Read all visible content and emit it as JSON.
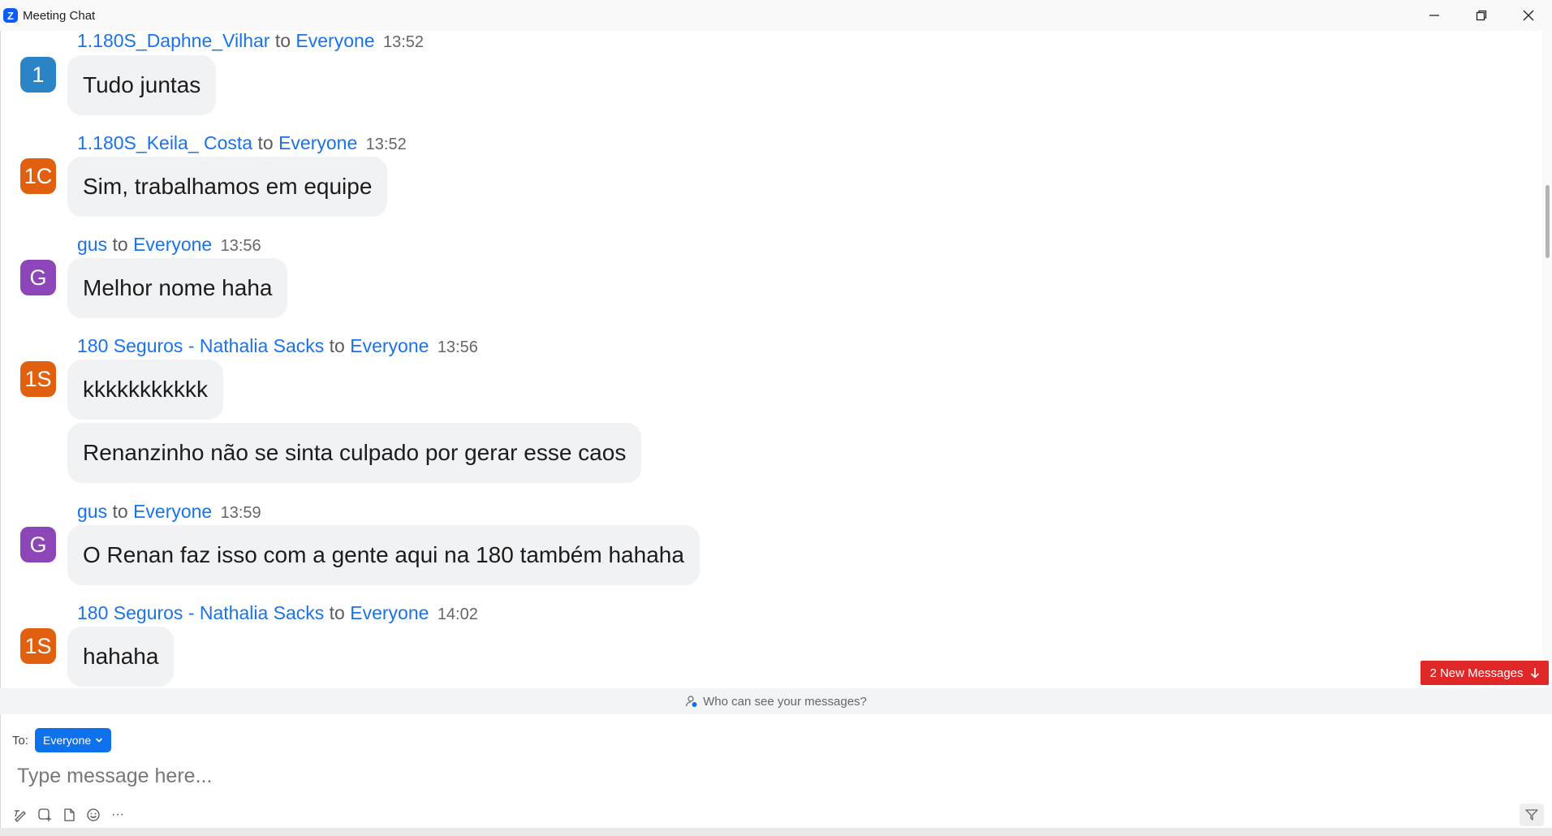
{
  "window": {
    "title": "Meeting Chat",
    "app_logo_letter": "Z"
  },
  "messages": [
    {
      "sender": "1.180S_Daphne_Vilhar",
      "to_word": "to",
      "recipient": "Everyone",
      "time": "13:52",
      "avatar_text": "1",
      "avatar_color": "#2b84c6",
      "bubbles": [
        "Tudo juntas"
      ]
    },
    {
      "sender": "1.180S_Keila_ Costa",
      "to_word": "to",
      "recipient": "Everyone",
      "time": "13:52",
      "avatar_text": "1C",
      "avatar_color": "#e0600f",
      "bubbles": [
        "Sim, trabalhamos em equipe"
      ]
    },
    {
      "sender": "gus",
      "to_word": "to",
      "recipient": "Everyone",
      "time": "13:56",
      "avatar_text": "G",
      "avatar_color": "#8c46b8",
      "bubbles": [
        "Melhor nome haha"
      ]
    },
    {
      "sender": "180 Seguros - Nathalia Sacks",
      "to_word": "to",
      "recipient": "Everyone",
      "time": "13:56",
      "avatar_text": "1S",
      "avatar_color": "#e0600f",
      "bubbles": [
        "kkkkkkkkkkk",
        "Renanzinho não se sinta culpado por gerar esse caos"
      ]
    },
    {
      "sender": "gus",
      "to_word": "to",
      "recipient": "Everyone",
      "time": "13:59",
      "avatar_text": "G",
      "avatar_color": "#8c46b8",
      "bubbles": [
        "O Renan faz isso com a gente aqui na 180 também hahaha"
      ]
    },
    {
      "sender": "180 Seguros - Nathalia Sacks",
      "to_word": "to",
      "recipient": "Everyone",
      "time": "14:02",
      "avatar_text": "1S",
      "avatar_color": "#e0600f",
      "bubbles": [
        "hahaha"
      ]
    }
  ],
  "new_messages_button": {
    "label": "2 New Messages",
    "color": "#e02828"
  },
  "visibility": {
    "label": "Who can see your messages?"
  },
  "composer": {
    "to_label": "To:",
    "recipient_value": "Everyone",
    "placeholder": "Type message here...",
    "accent": "#0e72ed",
    "toolbar_icons": [
      "format-icon",
      "screenshot-icon",
      "file-icon",
      "emoji-icon",
      "more-icon"
    ],
    "more_label": "···"
  }
}
